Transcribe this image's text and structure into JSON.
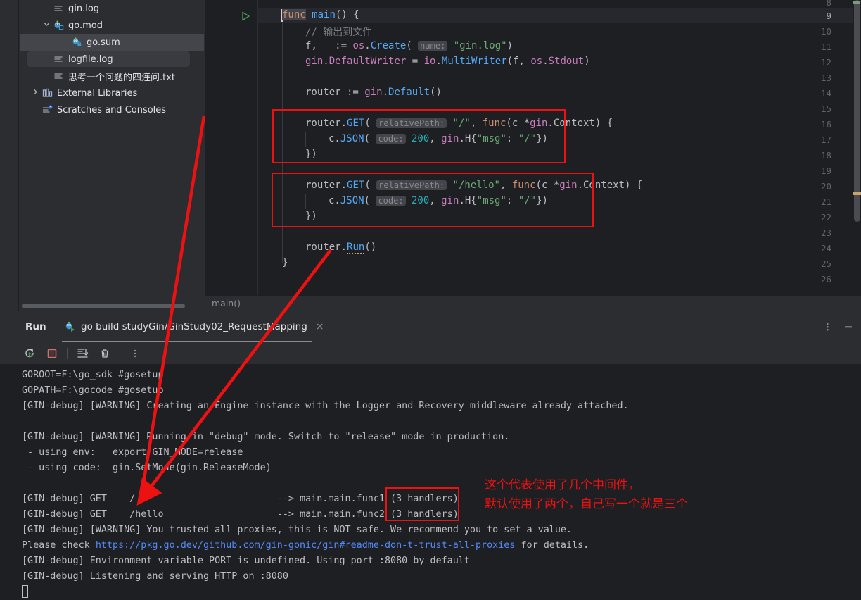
{
  "sidebar": {
    "items": [
      {
        "label": "gin.log",
        "icon": "file-log-icon",
        "indent": 2,
        "arrow": "",
        "state": "normal"
      },
      {
        "label": "go.mod",
        "icon": "go-file-icon",
        "indent": 1,
        "arrow": "v",
        "state": "normal"
      },
      {
        "label": "go.sum",
        "icon": "go-lock-file-icon",
        "indent": 2,
        "arrow": "",
        "state": "selected-focus"
      },
      {
        "label": "logfile.log",
        "icon": "file-log-icon",
        "indent": 2,
        "arrow": "",
        "state": "selected-hover"
      },
      {
        "label": "思考一个问题的四连问.txt",
        "icon": "file-text-icon",
        "indent": 2,
        "arrow": "",
        "state": "normal"
      },
      {
        "label": "External Libraries",
        "icon": "library-icon",
        "indent": 1,
        "arrow": ">",
        "state": "normal"
      },
      {
        "label": "Scratches and Consoles",
        "icon": "scratches-icon",
        "indent": 1,
        "arrow": "",
        "state": "normal"
      }
    ]
  },
  "editor": {
    "breadcrumb": "main()",
    "first_line_number": 8,
    "current_line": 9,
    "lines": [
      {
        "n": 8,
        "text": ""
      },
      {
        "n": 9,
        "text": "func main() {"
      },
      {
        "n": 10,
        "text": "    // 输出到文件"
      },
      {
        "n": 11,
        "text": "    f, _ := os.Create( name: \"gin.log\")"
      },
      {
        "n": 12,
        "text": "    gin.DefaultWriter = io.MultiWriter(f, os.Stdout)"
      },
      {
        "n": 13,
        "text": ""
      },
      {
        "n": 14,
        "text": "    router := gin.Default()"
      },
      {
        "n": 15,
        "text": ""
      },
      {
        "n": 16,
        "text": "    router.GET( relativePath: \"/\", func(c *gin.Context) {"
      },
      {
        "n": 17,
        "text": "        c.JSON( code: 200, gin.H{\"msg\": \"/\"})"
      },
      {
        "n": 18,
        "text": "    })"
      },
      {
        "n": 19,
        "text": ""
      },
      {
        "n": 20,
        "text": "    router.GET( relativePath: \"/hello\", func(c *gin.Context) {"
      },
      {
        "n": 21,
        "text": "        c.JSON( code: 200, gin.H{\"msg\": \"/\"})"
      },
      {
        "n": 22,
        "text": "    })"
      },
      {
        "n": 23,
        "text": ""
      },
      {
        "n": 24,
        "text": "    router.Run()"
      },
      {
        "n": 25,
        "text": "}"
      },
      {
        "n": 26,
        "text": ""
      }
    ],
    "parameter_hints": [
      "name:",
      "relativePath:",
      "code:"
    ]
  },
  "run_panel": {
    "title": "Run",
    "tab_label": "go build studyGin/GinStudy02_RequestMapping",
    "tab_close": "×",
    "toolbar": [
      {
        "name": "rerun-button",
        "tooltip": "Rerun"
      },
      {
        "name": "stop-button",
        "tooltip": "Stop"
      },
      {
        "name": "scroll-to-end-button",
        "tooltip": "Scroll to End"
      },
      {
        "name": "clear-all-button",
        "tooltip": "Clear All"
      },
      {
        "name": "more-options-button",
        "tooltip": "More"
      }
    ],
    "header_right": [
      {
        "name": "options-menu-button",
        "tooltip": "Options"
      },
      {
        "name": "minimize-button",
        "tooltip": "Hide"
      }
    ],
    "console_lines": [
      {
        "text": "GOROOT=F:\\go_sdk #gosetup"
      },
      {
        "text": "GOPATH=F:\\gocode #gosetup"
      },
      {
        "text": "[GIN-debug] [WARNING] Creating an Engine instance with the Logger and Recovery middleware already attached."
      },
      {
        "text": ""
      },
      {
        "text": "[GIN-debug] [WARNING] Running in \"debug\" mode. Switch to \"release\" mode in production."
      },
      {
        "text": " - using env:   export GIN_MODE=release"
      },
      {
        "text": " - using code:  gin.SetMode(gin.ReleaseMode)"
      },
      {
        "text": ""
      },
      {
        "text": "[GIN-debug] GET    /                         --> main.main.func1 (3 handlers)"
      },
      {
        "text": "[GIN-debug] GET    /hello                    --> main.main.func2 (3 handlers)"
      },
      {
        "text": "[GIN-debug] [WARNING] You trusted all proxies, this is NOT safe. We recommend you to set a value."
      },
      {
        "text": "Please check ",
        "link": "https://pkg.go.dev/github.com/gin-gonic/gin#readme-don-t-trust-all-proxies",
        "suffix": " for details."
      },
      {
        "text": "[GIN-debug] Environment variable PORT is undefined. Using port :8080 by default"
      },
      {
        "text": "[GIN-debug] Listening and serving HTTP on :8080"
      }
    ]
  },
  "annotations": {
    "color": "#ee1111",
    "note_line1": "这个代表使用了几个中间件，",
    "note_line2": "默认使用了两个，自己写一个就是三个",
    "boxes": [
      {
        "name": "route-root-highlight-box"
      },
      {
        "name": "route-hello-highlight-box"
      },
      {
        "name": "handlers-count-highlight-box"
      }
    ]
  }
}
